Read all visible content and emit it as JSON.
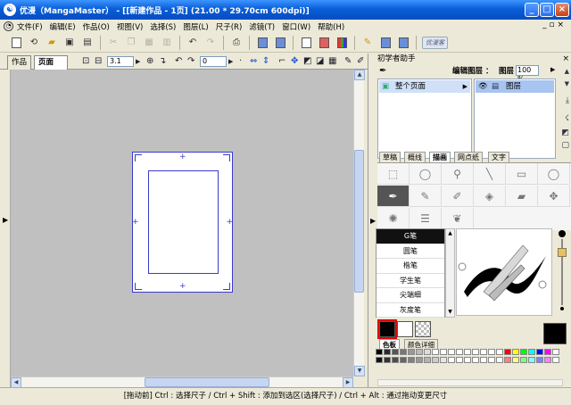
{
  "window": {
    "title": "优漫（MangaMaster） - [[新建作品 - 1页] (21.00 * 29.70cm 600dpi)]",
    "app_glyph": "☯"
  },
  "menubar": {
    "items": [
      "文件(F)",
      "编辑(E)",
      "作品(O)",
      "视图(V)",
      "选择(S)",
      "图层(L)",
      "尺子(R)",
      "滤镜(T)",
      "窗口(W)",
      "帮助(H)"
    ]
  },
  "toolbar": {
    "brand_button": "优漫客"
  },
  "doc": {
    "tabs": [
      "作品",
      "页面"
    ],
    "tab_close": "×",
    "zoom": "3.1",
    "angle": "0"
  },
  "panel": {
    "title": "初学者助手",
    "close": "×",
    "edit_layer_label": "编辑图层 ：",
    "layer_label": "图层",
    "layer_percent": "100 %",
    "pages_item": "整个页面",
    "layer_item": "图层",
    "tool_tabs": [
      "草稿",
      "概线",
      "描画",
      "网点纸",
      "文字"
    ],
    "pens": [
      "G笔",
      "圆笔",
      "楷笔",
      "学生笔",
      "尖端细",
      "灰度笔"
    ],
    "color_tabs": [
      "色板",
      "颜色详细"
    ]
  },
  "colors": {
    "accent": "#0a5fd8",
    "palette_row1": [
      "#000000",
      "#2a2a2a",
      "#555555",
      "#777777",
      "#999999",
      "#bbbbbb",
      "#dddddd",
      "#ffffff",
      "#ffffff",
      "#ffffff",
      "#ffffff",
      "#ffffff",
      "#ffffff",
      "#ffffff",
      "#ffffff",
      "#ffffff",
      "#ff0000",
      "#ffff00",
      "#00ff00",
      "#00ffff",
      "#0000ff",
      "#ff00ff",
      "#ffffff"
    ],
    "palette_row2": [
      "#111111",
      "#333333",
      "#4d4d4d",
      "#666666",
      "#808080",
      "#999999",
      "#b3b3b3",
      "#cccccc",
      "#e6e6e6",
      "#ffffff",
      "#ffffff",
      "#ffffff",
      "#ffffff",
      "#ffffff",
      "#ffffff",
      "#ffffff",
      "#ff8080",
      "#ffff80",
      "#80ff80",
      "#80ffff",
      "#8080ff",
      "#ff80ff",
      "#ffffff"
    ]
  },
  "status": {
    "text": "[拖动前] Ctrl : 选择尺子 / Ctrl + Shift : 添加到选区(选择尺子) / Ctrl + Alt : 通过拖动变更尺寸"
  }
}
